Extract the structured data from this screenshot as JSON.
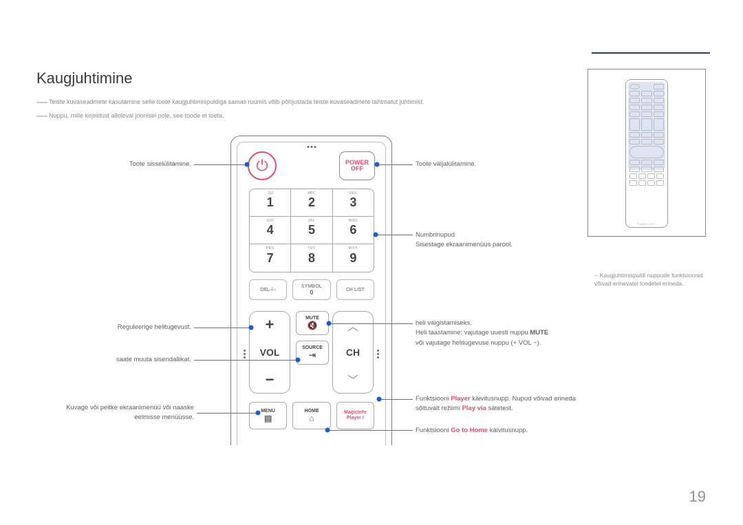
{
  "page_number": "19",
  "heading": "Kaugjuhtimine",
  "notes": {
    "n1": "Teiste kuvaseadmete kasutamine selle toote kaugjuhtimispuldiga samas ruumis võib põhjustada teiste kuvaseadmete tahtmatut juhtimist.",
    "n2": "Nuppu, mille kirjeldust alloleval joonisel pole, see toode ei toeta."
  },
  "side_note": "Kaugjuhtimispuldi nuppude funktsioonid võivad erinevatel toodetel erineda.",
  "remote": {
    "power_off_top": "POWER",
    "power_off_bottom": "OFF",
    "numpad": [
      {
        "sup": ".QZ",
        "dig": "1"
      },
      {
        "sup": "ABC",
        "dig": "2"
      },
      {
        "sup": "DEF",
        "dig": "3"
      },
      {
        "sup": "GHI",
        "dig": "4"
      },
      {
        "sup": "JKL",
        "dig": "5"
      },
      {
        "sup": "MNO",
        "dig": "6"
      },
      {
        "sup": "PRS",
        "dig": "7"
      },
      {
        "sup": "TUV",
        "dig": "8"
      },
      {
        "sup": "WXY",
        "dig": "9"
      }
    ],
    "row4": {
      "del": "DEL-/--",
      "symbol": "SYMBOL",
      "zero": "0",
      "chlist": "CH LIST"
    },
    "vol": "VOL",
    "ch": "CH",
    "mute": "MUTE",
    "source": "SOURCE",
    "menu": "MENU",
    "home": "HOME",
    "magic1": "MagicInfo",
    "magic2": "Player I",
    "mini_brand": "SAMSUNG"
  },
  "callouts": {
    "power_on": "Toote sisselülitamine.",
    "power_off": "Toote väljalülitamine.",
    "num1": "Numbrinupud",
    "num2": "Sisestage ekraanimenüüs parool.",
    "vol": "Reguleerige helitugevust.",
    "source": "saate muuta sisendallikat.",
    "menu": "Kuvage või peitke ekraanimenüü või naaske eelmisse menüüsse.",
    "mute1": "heli vaigistamiseks.",
    "mute2_a": "Heli taastamine: vajutage uuesti nuppu ",
    "mute2_b": "MUTE",
    "mute3": "või vajutage helitugevuse nuppu (+ VOL −).",
    "player_a": "Funktsiooni ",
    "player_b": "Player",
    "player_c": " käivitusnupp. Nupud võivad erineda sõltuvalt režiimi ",
    "player_d": "Play via",
    "player_e": " sätetest.",
    "home_a": "Funktsiooni ",
    "home_b": "Go to Home",
    "home_c": " käivitusnupp."
  }
}
